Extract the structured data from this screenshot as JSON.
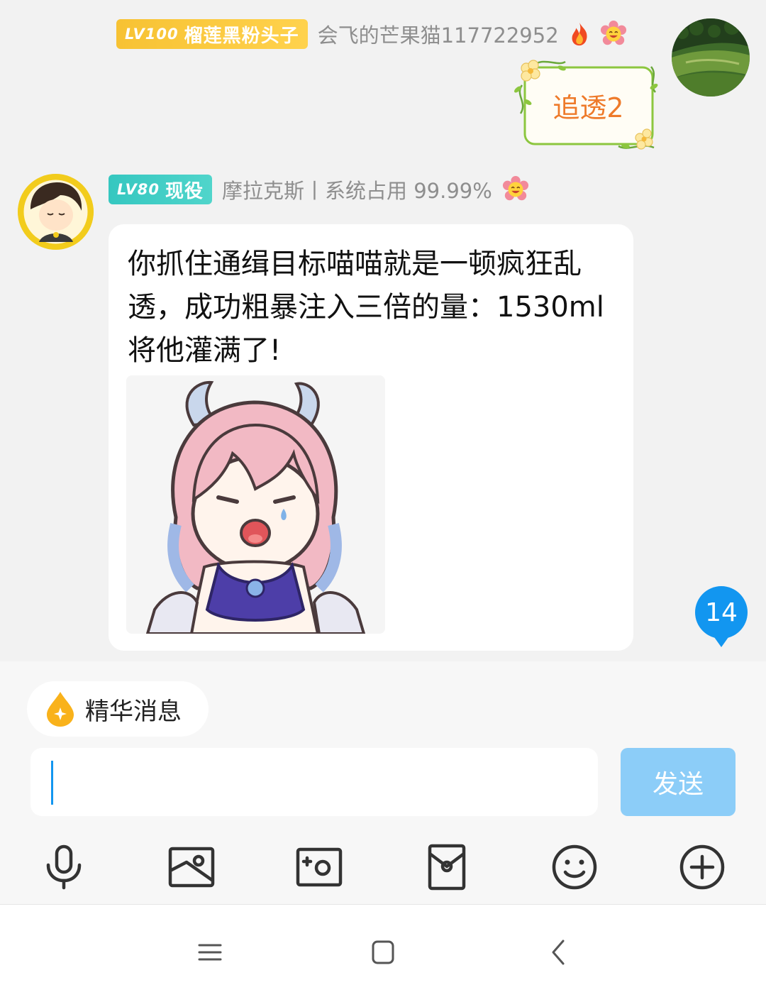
{
  "messages": [
    {
      "level_tag": "LV100",
      "title_badge": "榴莲黑粉头子",
      "nickname": "会飞的芒果猫117722952",
      "text": "追透2"
    },
    {
      "level_tag": "LV80",
      "title_badge": "现役",
      "nickname": "摩拉克斯丨系统占用 99.99%",
      "text": "你抓住通缉目标喵喵就是一顿疯狂乱透，成功粗暴注入三倍的量：1530ml将他灌满了!"
    }
  ],
  "unread_count": "14",
  "essence_label": "精华消息",
  "input": {
    "value": "",
    "placeholder": ""
  },
  "send_label": "发送",
  "toolbar_icons": [
    "microphone-icon",
    "image-icon",
    "camera-icon",
    "red-packet-icon",
    "emoji-icon",
    "plus-icon"
  ],
  "nav_icons": [
    "menu-icon",
    "home-icon",
    "back-icon"
  ],
  "colors": {
    "accent": "#1296f0",
    "send_disabled": "#8ccdf8",
    "level_gold": "#f7c233",
    "level_teal": "#35c7c0",
    "nickname": "#8e8e8e",
    "bubble_text_orange": "#ee7a2a"
  }
}
